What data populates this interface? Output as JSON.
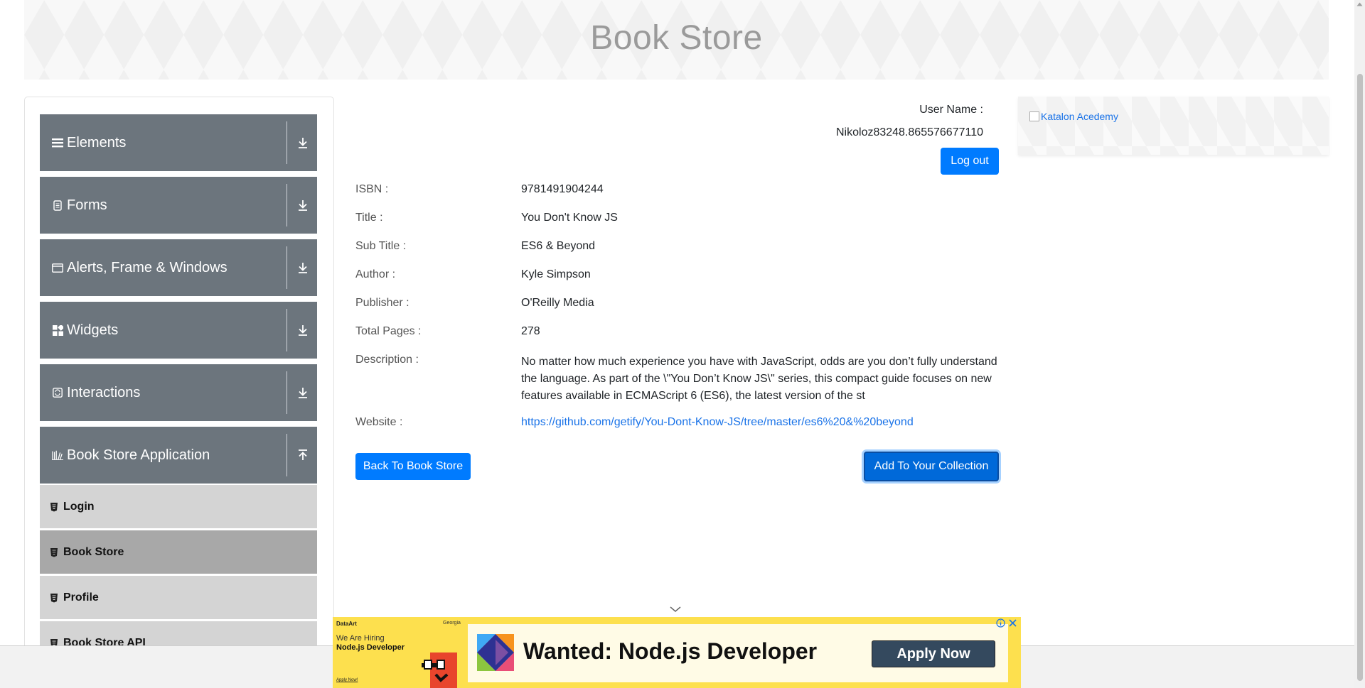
{
  "header": {
    "title": "Book Store"
  },
  "sidebar": {
    "groups": [
      {
        "label": "Elements",
        "icon": "list-icon"
      },
      {
        "label": "Forms",
        "icon": "document-icon"
      },
      {
        "label": "Alerts, Frame & Windows",
        "icon": "window-icon"
      },
      {
        "label": "Widgets",
        "icon": "widgets-icon"
      },
      {
        "label": "Interactions",
        "icon": "interactions-icon"
      },
      {
        "label": "Book Store Application",
        "icon": "books-icon"
      }
    ],
    "subitems": [
      {
        "label": "Login"
      },
      {
        "label": "Book Store"
      },
      {
        "label": "Profile"
      },
      {
        "label": "Book Store API"
      }
    ]
  },
  "user": {
    "label": "User Name :",
    "value": "Nikoloz83248.865576677110",
    "logout_label": "Log out"
  },
  "book": {
    "isbn_label": "ISBN :",
    "isbn": "9781491904244",
    "title_label": "Title :",
    "title": "You Don't Know JS",
    "subtitle_label": "Sub Title :",
    "subtitle": "ES6 & Beyond",
    "author_label": "Author :",
    "author": "Kyle Simpson",
    "publisher_label": "Publisher :",
    "publisher": "O'Reilly Media",
    "pages_label": "Total Pages :",
    "pages": "278",
    "description_label": "Description :",
    "description": "No matter how much experience you have with JavaScript, odds are you don’t fully understand the language. As part of the \\\"You Don’t Know JS\\\" series, this compact guide focuses on new features available in ECMAScript 6 (ES6), the latest version of the st",
    "website_label": "Website :",
    "website": "https://github.com/getify/You-Dont-Know-JS/tree/master/es6%20&%20beyond"
  },
  "actions": {
    "back_label": "Back To Book Store",
    "add_label": "Add To Your Collection"
  },
  "side_ad": {
    "alt_text": "Katalon Acedemy"
  },
  "bottom_ad": {
    "brand": "DataArt",
    "location": "Georgia",
    "hiring": "We Are Hiring",
    "role": "Node.js Developer",
    "apply_small": "Apply Now!",
    "headline": "Wanted: Node.js Developer",
    "cta": "Apply Now"
  },
  "colors": {
    "primary": "#007bff",
    "sidebar_group": "#6c757d",
    "sidebar_sub": "#d4d4d4",
    "sidebar_sub_active": "#a8a8a8",
    "ad_yellow": "#fde04e",
    "ad_cta": "#34495e"
  }
}
